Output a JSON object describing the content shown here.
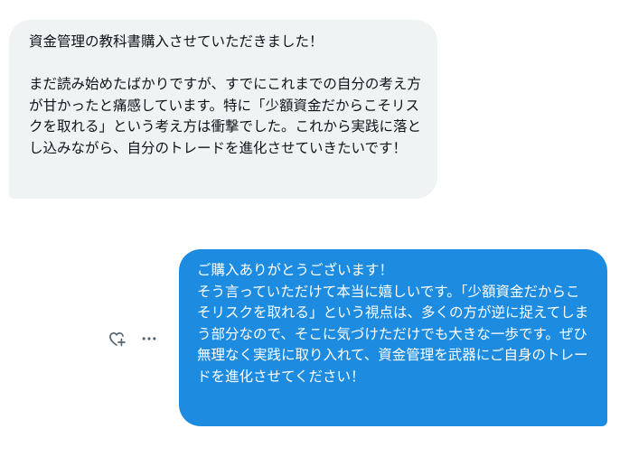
{
  "messages": {
    "received": {
      "text": "資金管理の教科書購入させていただきました！\n\nまだ読み始めたばかりですが、すでにこれまでの自分の考え方が甘かったと痛感しています。特に「少額資金だからこそリスクを取れる」という考え方は衝撃でした。これから実践に落とし込みながら、自分のトレードを進化させていきたいです！"
    },
    "sent": {
      "text": "ご購入ありがとうございます！\nそう言っていただけて本当に嬉しいです。「少額資金だからこそリスクを取れる」という視点は、多くの方が逆に捉えてしまう部分なので、そこに気づけただけでも大きな一歩です。ぜひ無理なく実践に取り入れて、資金管理を武器にご自身のトレードを進化させてください！"
    }
  },
  "actions": {
    "react_icon": "heart-plus-icon",
    "more_icon": "more-horizontal-icon"
  },
  "colors": {
    "received_bg": "#eff3f4",
    "received_text": "#0f1419",
    "sent_bg": "#1d8ce0",
    "sent_text": "#ffffff",
    "icon": "#536471"
  }
}
